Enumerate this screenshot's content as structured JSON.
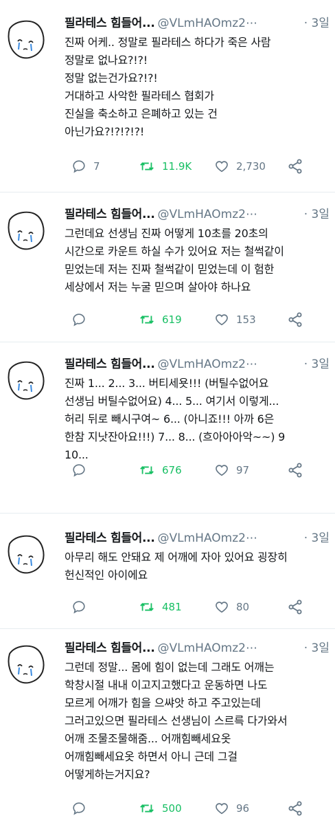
{
  "tweets": [
    {
      "name": "필라테스 힘들어...",
      "handle": "@VLmHAOmz2⋯",
      "time": "· 3일",
      "lines": [
        "진짜 어케.. 정말로 필라테스 하다가 죽은 사람",
        "정말로 없나요?!?!",
        "정말 없는건가요?!?!",
        "거대하고 사악한 필라테스 협회가",
        "진실을 축소하고 은폐하고 있는 건",
        "아닌가요?!?!?!?!"
      ],
      "replies": "7",
      "retweets": "11.9K",
      "likes": "2,730"
    },
    {
      "name": "필라테스 힘들어...",
      "handle": "@VLmHAOmz2⋯",
      "time": "· 3일",
      "lines": [
        "그런데요 선생님 진짜 어떻게 10초를 20초의",
        "시간으로 카운트 하실 수가 있어요 저는 철썩같이",
        "믿었는데 저는 진짜 철썩같이 믿었는데 이 험한",
        "세상에서 저는 누굴 믿으며 살아야 하나요"
      ],
      "replies": "",
      "retweets": "619",
      "likes": "153"
    },
    {
      "name": "필라테스 힘들어...",
      "handle": "@VLmHAOmz2⋯",
      "time": "· 3일",
      "lines": [
        "진짜 1... 2... 3... 버티세욧!!! (버틸수없어요",
        "선생님 버틸수없어요) 4... 5... 여기서 이렇게...",
        "허리 뒤로 빼시구여~ 6... (아니죠!!! 아까 6은",
        "한참 지낫잔아요!!!) 7... 8... (흐아아아악~~) 9",
        "10..."
      ],
      "replies": "",
      "retweets": "676",
      "likes": "97"
    },
    {
      "name": "필라테스 힘들어...",
      "handle": "@VLmHAOmz2⋯",
      "time": "· 3일",
      "lines": [
        "아무리 해도 안돼요 제 어깨에 자아 있어요 굉장히",
        "헌신적인 아이에요"
      ],
      "replies": "",
      "retweets": "481",
      "likes": "80"
    },
    {
      "name": "필라테스 힘들어...",
      "handle": "@VLmHAOmz2⋯",
      "time": "· 3일",
      "lines": [
        "그런데 정말... 몸에 힘이 없는데 그래도 어깨는",
        "학창시절 내내 이고지고했다고 운동하면 나도",
        "모르게 어깨가 힘을 으쌰앗 하고 주고있는데",
        "그러고있으면 필라테스 선생님이 스르륵 다가와서",
        "어깨 조물조물해줌... 어깨힘빼세요옷",
        "어깨힘빼세요옷 하면서 아니 근데 그걸",
        "어떻게하는거지요?"
      ],
      "replies": "",
      "retweets": "500",
      "likes": "96"
    }
  ],
  "icons": {
    "reply": "reply-icon",
    "retweet": "retweet-icon",
    "like": "heart-icon",
    "share": "share-icon",
    "avatar": "crying-face-avatar"
  },
  "colors": {
    "text": "#14171a",
    "secondary": "#657786",
    "retweet": "#17bf63",
    "divider": "#e6ecf0"
  }
}
